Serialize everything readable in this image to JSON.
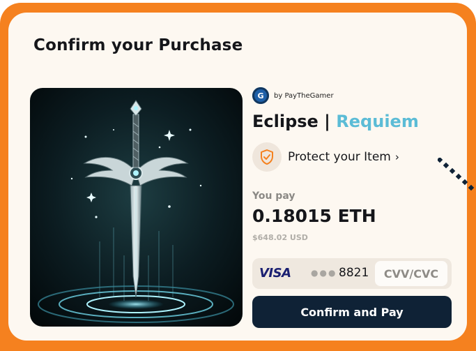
{
  "header": {
    "title": "Confirm your Purchase"
  },
  "product": {
    "brand_logo_letter": "G",
    "brand": "by PayTheGamer",
    "name_main": "Eclipse |",
    "name_accent": "Requiem",
    "image": "sword-artwork"
  },
  "protection": {
    "label": "Protect your Item",
    "chevron": "›",
    "icon": "shield-check-icon"
  },
  "payment": {
    "label": "You pay",
    "amount": "0.18015 ETH",
    "usd": "$648.02 USD"
  },
  "card": {
    "brand": "VISA",
    "masked": "●●●",
    "last4": "8821",
    "cvv_placeholder": "CVV/CVC",
    "cvv_value": ""
  },
  "actions": {
    "confirm_label": "Confirm and Pay"
  },
  "colors": {
    "frame": "#f5811f",
    "card_bg": "#fdf8f1",
    "accent": "#5bbcd6",
    "button": "#0f2236",
    "visa": "#1a1f71"
  }
}
